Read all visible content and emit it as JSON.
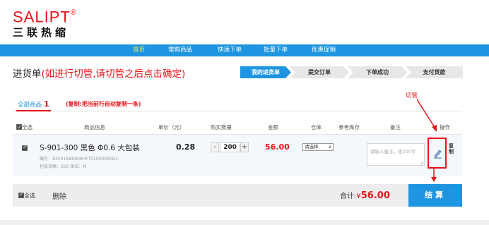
{
  "logo": {
    "latin": "SALIPT",
    "reg": "®",
    "cn": "三联热缩"
  },
  "nav": {
    "items": [
      {
        "label": "首页",
        "active": true
      },
      {
        "label": "常购商品"
      },
      {
        "label": "快速下单"
      },
      {
        "label": "批量下单"
      },
      {
        "label": "优惠促销"
      }
    ]
  },
  "page": {
    "title": "进货单",
    "title_note": "(如进行切管,请切管之后点击确定)"
  },
  "steps": {
    "items": [
      "我的进货单",
      "提交订单",
      "下单成功",
      "支付货款"
    ],
    "active_index": 0
  },
  "colors": {
    "accent": "#1e95e0",
    "red": "#e8141b",
    "highlight": "#ffe14a"
  },
  "tabs": {
    "all_label": "全部商品",
    "all_count": "1",
    "hint": "(复制:把当前行自动复制一条)"
  },
  "annotation": {
    "label": "切管"
  },
  "table": {
    "headers": {
      "select_all": "全选",
      "info": "商品信息",
      "price": "单价（元）",
      "qty": "购买数量",
      "amount": "金额",
      "warehouse": "仓库",
      "stock": "参考库存",
      "note": "备注",
      "ops": "操作"
    },
    "rows": [
      {
        "name": "S-901-300 黑色 Φ0.6 大包装",
        "code": "编号：83501ABK009HFT01000000D1",
        "pack": "包装规格：200   单位：M",
        "price": "0.28",
        "qty": "200",
        "amount": "56.00",
        "warehouse": "请选择",
        "note_placeholder": "请输入备注，限200字",
        "copy_label": "复制",
        "cut_icon": "pencil-cut-icon"
      }
    ]
  },
  "footer": {
    "select_all": "全选",
    "delete": "删除",
    "total_label": "合计:",
    "currency": "¥",
    "total": "56.00",
    "checkout": "结算"
  }
}
